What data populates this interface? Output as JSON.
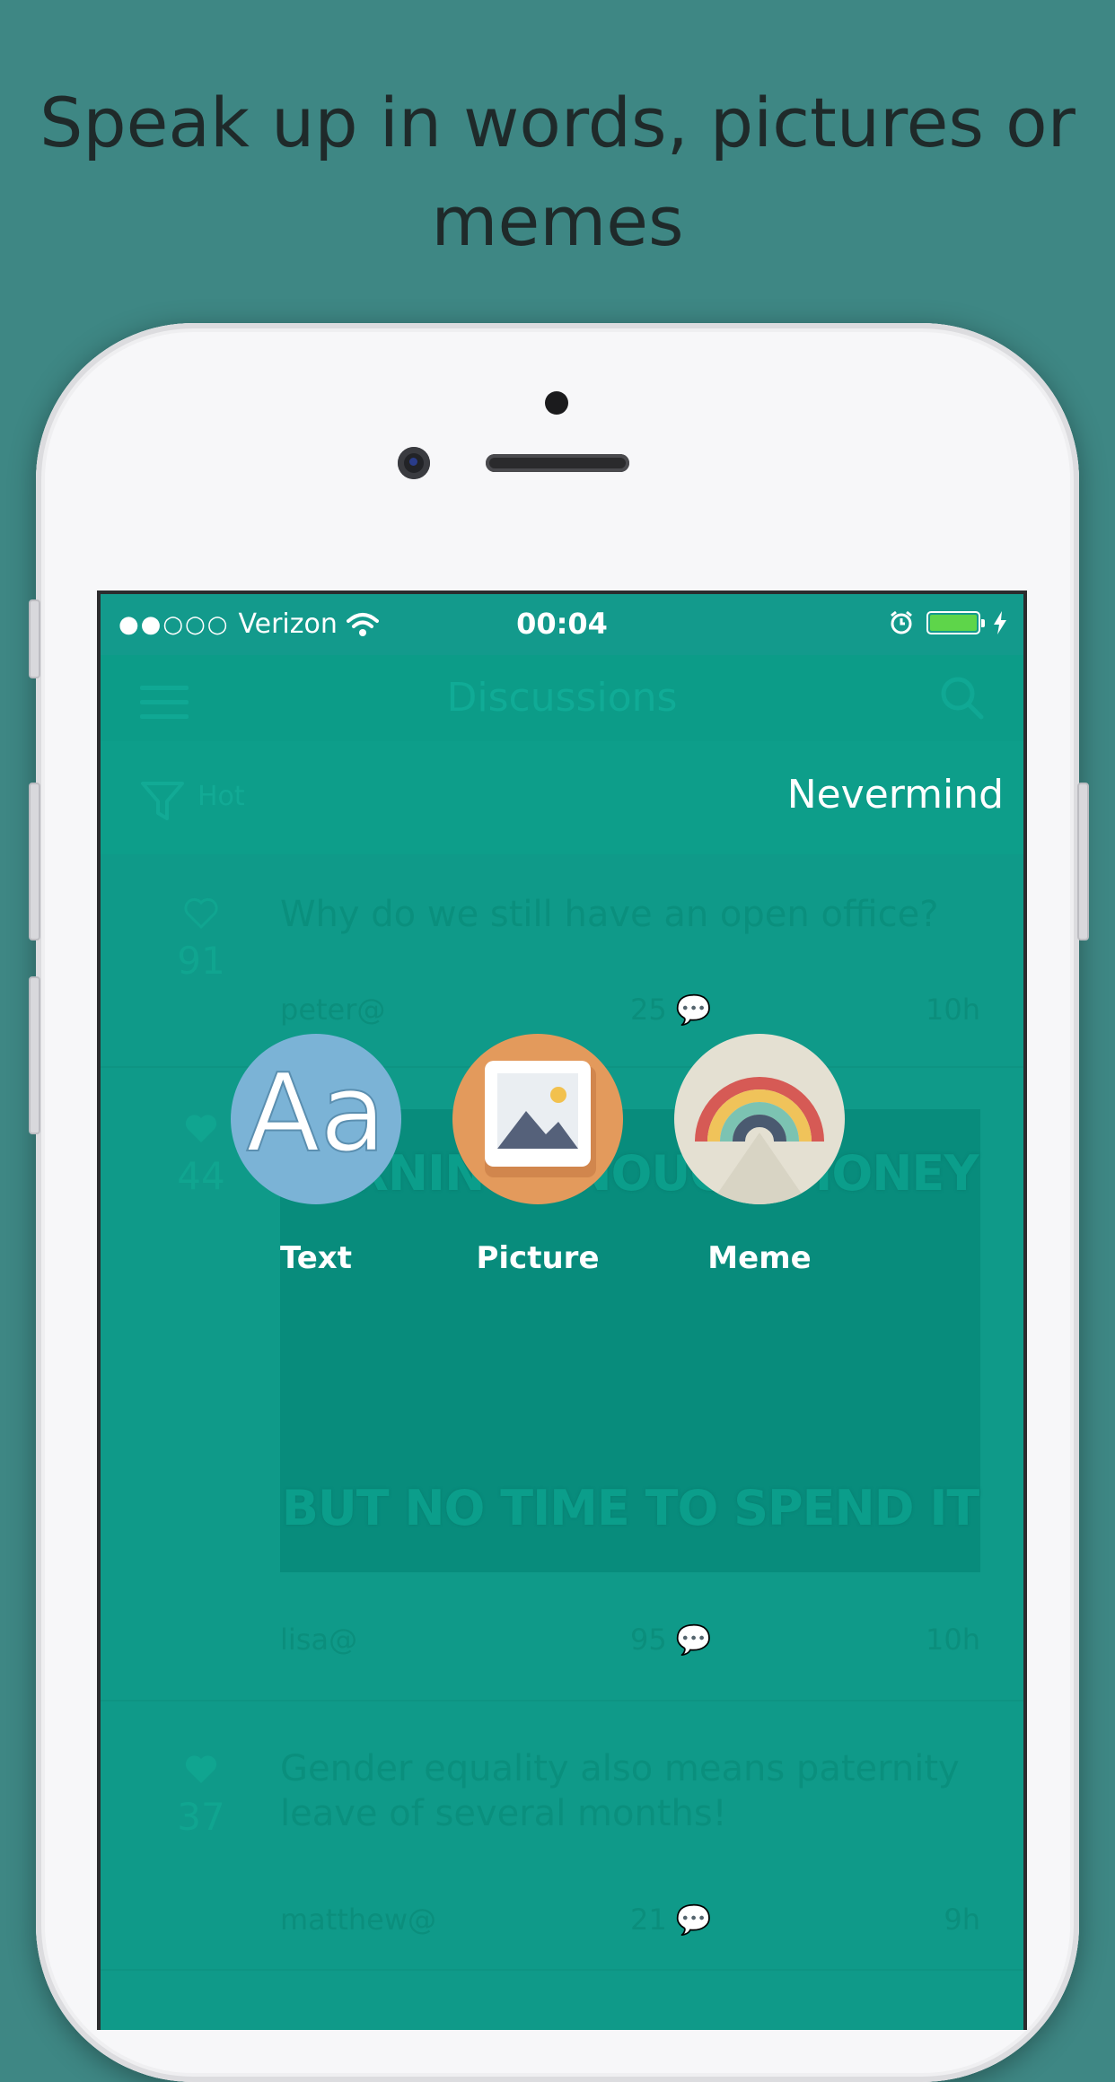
{
  "headline": "Speak up in words, pictures or memes",
  "status_bar": {
    "signal": "●●○○○",
    "carrier": "Verizon",
    "time": "00:04"
  },
  "nav": {
    "title": "Discussions",
    "menu_icon": "hamburger-menu-icon",
    "search_icon": "search-icon"
  },
  "filter": {
    "label": "Hot",
    "cancel_label": "Nevermind"
  },
  "posts": [
    {
      "votes": "91",
      "text": "Why do we still have an open office?",
      "author": "peter@",
      "comments": "25",
      "age": "10h"
    },
    {
      "votes": "44",
      "meme_top": "EARNING ENOUGH MONEY",
      "meme_bottom": "BUT NO TIME TO SPEND IT",
      "author": "lisa@",
      "comments": "95",
      "age": "10h"
    },
    {
      "votes": "37",
      "text": "Gender equality also means paternity leave of several months!",
      "author": "matthew@",
      "comments": "21",
      "age": "9h"
    }
  ],
  "actions": [
    {
      "label": "Text",
      "icon": "text-aa-icon",
      "color": "#7bb3d6"
    },
    {
      "label": "Picture",
      "icon": "picture-icon",
      "color": "#e39a5c"
    },
    {
      "label": "Meme",
      "icon": "rainbow-meme-icon",
      "color": "#e4e0d2"
    }
  ],
  "colors": {
    "background": "#3e8784",
    "screen_teal": "#139a8c",
    "battery": "#5ed54a"
  }
}
